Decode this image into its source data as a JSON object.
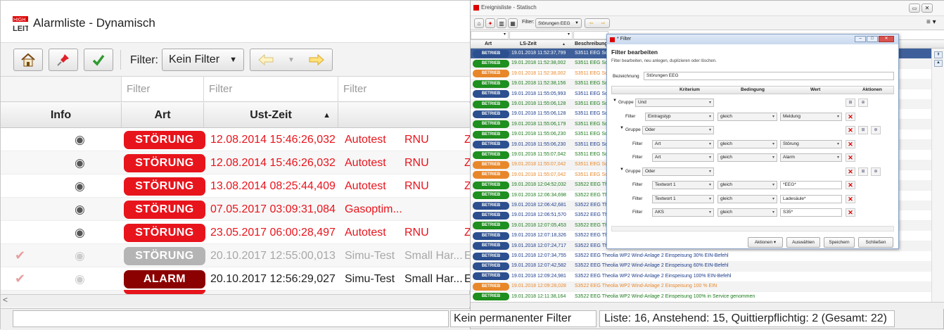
{
  "main": {
    "title": "Alarmliste - Dynamisch",
    "toolbar": {
      "filter_label": "Filter:",
      "filter_value": "Kein Filter"
    },
    "filter_placeholders": [
      "Filter",
      "Filter",
      "Filter"
    ],
    "columns": {
      "info": "Info",
      "art": "Art",
      "ust_zeit": "Ust-Zeit"
    },
    "rows": [
      {
        "art": "STÖRUNG",
        "zeit": "12.08.2014 15:46:26,032",
        "text": "Autotest",
        "kz": "RNU",
        "extra": "Z",
        "badge": "#e8141c",
        "fg": "#e8141c",
        "ack": false
      },
      {
        "art": "STÖRUNG",
        "zeit": "12.08.2014 15:46:26,032",
        "text": "Autotest",
        "kz": "RNU",
        "extra": "Z",
        "badge": "#e8141c",
        "fg": "#e8141c",
        "ack": false
      },
      {
        "art": "STÖRUNG",
        "zeit": "13.08.2014 08:25:44,409",
        "text": "Autotest",
        "kz": "RNU",
        "extra": "Z",
        "badge": "#e8141c",
        "fg": "#e8141c",
        "ack": false
      },
      {
        "art": "STÖRUNG",
        "zeit": "07.05.2017 03:09:31,084",
        "text": "Gasoptim...",
        "kz": "",
        "extra": "",
        "badge": "#e8141c",
        "fg": "#e8141c",
        "ack": false
      },
      {
        "art": "STÖRUNG",
        "zeit": "23.05.2017 06:00:28,497",
        "text": "Autotest",
        "kz": "RNU",
        "extra": "Z",
        "badge": "#e8141c",
        "fg": "#e8141c",
        "ack": false
      },
      {
        "art": "STÖRUNG",
        "zeit": "20.10.2017 12:55:00,013",
        "text": "Simu-Test",
        "kz": "Small Har...",
        "extra": "E",
        "badge": "#b4b4b4",
        "fg": "#a8a8a8",
        "ack": true
      },
      {
        "art": "ALARM",
        "zeit": "20.10.2017 12:56:29,027",
        "text": "Simu-Test",
        "kz": "Small Har...",
        "extra": "E",
        "badge": "#8b0000",
        "fg": "#222222",
        "ack": true
      }
    ],
    "status": {
      "permanent": "Kein permanenter Filter",
      "summary": "Liste: 16, Anstehend: 15, Quittierpflichtig: 2 (Gesamt: 22)"
    }
  },
  "events": {
    "title": "Ereignisliste - Statisch",
    "filter_label": "Filter:",
    "filter_value": "Störungen EEG",
    "columns": {
      "art": "Art",
      "ls_zeit": "LS-Zeit",
      "beschreibung": "Beschreibung"
    },
    "rows": [
      {
        "b": "BETRIEB",
        "c": "#2c4f8f",
        "t": "19.01.2018 11:52:37,799",
        "d": "S3511 EEG Son",
        "fg": "#1a3a8a",
        "sel": true
      },
      {
        "b": "BETRIEB",
        "c": "#1f8f1f",
        "t": "19.01.2018 11:52:38,002",
        "d": "S3511 EEG Son",
        "fg": "#1a7a1a"
      },
      {
        "b": "BETRIEB",
        "c": "#e8872a",
        "t": "19.01.2018 11:52:38,002",
        "d": "S3511 EEG Son",
        "fg": "#e8872a"
      },
      {
        "b": "BETRIEB",
        "c": "#1f8f1f",
        "t": "19.01.2018 11:52:38,156",
        "d": "S3511 EEG Son",
        "fg": "#1a7a1a"
      },
      {
        "b": "BETRIEB",
        "c": "#2c4f8f",
        "t": "19.01.2018 11:55:05,993",
        "d": "S3511 EEG Son",
        "fg": "#1a3a8a"
      },
      {
        "b": "BETRIEB",
        "c": "#1f8f1f",
        "t": "19.01.2018 11:55:06,128",
        "d": "S3511 EEG Son",
        "fg": "#1a7a1a"
      },
      {
        "b": "BETRIEB",
        "c": "#2c4f8f",
        "t": "19.01.2018 11:55:06,128",
        "d": "S3511 EEG Son",
        "fg": "#1a3a8a"
      },
      {
        "b": "BETRIEB",
        "c": "#1f8f1f",
        "t": "19.01.2018 11:55:06,179",
        "d": "S3511 EEG Son",
        "fg": "#1a7a1a"
      },
      {
        "b": "BETRIEB",
        "c": "#1f8f1f",
        "t": "19.01.2018 11:55:06,230",
        "d": "S3511 EEG Son",
        "fg": "#1a7a1a"
      },
      {
        "b": "BETRIEB",
        "c": "#2c4f8f",
        "t": "19.01.2018 11:55:06,230",
        "d": "S3511 EEG Son",
        "fg": "#1a3a8a"
      },
      {
        "b": "BETRIEB",
        "c": "#1f8f1f",
        "t": "19.01.2018 11:55:07,042",
        "d": "S3511 EEG Son",
        "fg": "#1a7a1a"
      },
      {
        "b": "BETRIEB",
        "c": "#e8872a",
        "t": "19.01.2018 11:55:07,042",
        "d": "S3511 EEG Son",
        "fg": "#e8872a"
      },
      {
        "b": "BETRIEB",
        "c": "#e8872a",
        "t": "19.01.2018 11:55:07,042",
        "d": "S3511 EEG Son",
        "fg": "#e8872a"
      },
      {
        "b": "BETRIEB",
        "c": "#1f8f1f",
        "t": "19.01.2018 12:04:52,032",
        "d": "S3522 EEG The",
        "fg": "#1a7a1a"
      },
      {
        "b": "BETRIEB",
        "c": "#1f8f1f",
        "t": "19.01.2018 12:06:34,698",
        "d": "S3522 EEG The",
        "fg": "#1a7a1a"
      },
      {
        "b": "BETRIEB",
        "c": "#2c4f8f",
        "t": "19.01.2018 12:06:42,681",
        "d": "S3522 EEG The",
        "fg": "#1a3a8a"
      },
      {
        "b": "BETRIEB",
        "c": "#2c4f8f",
        "t": "19.01.2018 12:06:51,570",
        "d": "S3522 EEG The",
        "fg": "#1a3a8a"
      },
      {
        "b": "BETRIEB",
        "c": "#1f8f1f",
        "t": "19.01.2018 12:07:05,453",
        "d": "S3522 EEG The",
        "fg": "#1a7a1a"
      },
      {
        "b": "BETRIEB",
        "c": "#2c4f8f",
        "t": "19.01.2018 12:07:18,326",
        "d": "S3522 EEG The",
        "fg": "#1a3a8a"
      },
      {
        "b": "BETRIEB",
        "c": "#2c4f8f",
        "t": "19.01.2018 12:07:24,717",
        "d": "S3522 EEG The",
        "fg": "#1a3a8a"
      },
      {
        "b": "BETRIEB",
        "c": "#2c4f8f",
        "t": "19.01.2018 12:07:34,755",
        "d": "S3522 EEG Theolia WP2 Wind-Anlage 2 Einspeisung 30% EIN-Befehl",
        "fg": "#1a3a8a"
      },
      {
        "b": "BETRIEB",
        "c": "#2c4f8f",
        "t": "19.01.2018 12:07:42,582",
        "d": "S3522 EEG Theolia WP2 Wind-Anlage 2 Einspeisung 60% EIN-Befehl",
        "fg": "#1a3a8a"
      },
      {
        "b": "BETRIEB",
        "c": "#2c4f8f",
        "t": "19.01.2018 12:09:24,981",
        "d": "S3522 EEG Theolia WP2 Wind-Anlage 2 Einspeisung 100% EIN-Befehl",
        "fg": "#1a3a8a"
      },
      {
        "b": "BETRIEB",
        "c": "#e8872a",
        "t": "19.01.2018 12:09:28,028",
        "d": "S3522 EEG Theolia WP2 Wind-Anlage 2 Einspeisung 100 % EIN",
        "fg": "#e8872a"
      },
      {
        "b": "BETRIEB",
        "c": "#1f8f1f",
        "t": "19.01.2018 12:11:38,164",
        "d": "S3522 EEG Theolia WP2 Wind-Anlage 2 Einspeisung 100% in Service genommen",
        "fg": "#1a7a1a"
      }
    ]
  },
  "dialog": {
    "window_title": "* Filter",
    "heading": "Filter bearbeiten",
    "subheading": "Filter bearbeiten, neu anlegen, duplizieren oder löschen.",
    "name_label": "Bezeichnung",
    "name_value": "Störungen EEG",
    "columns": {
      "kriterium": "Kriterium",
      "bedingung": "Bedingung",
      "wert": "Wert",
      "aktionen": "Aktionen"
    },
    "rows": [
      {
        "label": "Gruppe",
        "k": "Und",
        "b": "",
        "w": "",
        "wtype": "",
        "indent": 0,
        "x": false,
        "tools": true
      },
      {
        "label": "Filter",
        "k": "Eintragstyp",
        "b": "gleich",
        "w": "Meldung",
        "wtype": "dd",
        "indent": 1,
        "x": true,
        "tools": false
      },
      {
        "label": "Gruppe",
        "k": "Oder",
        "b": "",
        "w": "",
        "wtype": "",
        "indent": 1,
        "x": true,
        "tools": true
      },
      {
        "label": "Filter",
        "k": "Art",
        "b": "gleich",
        "w": "Störung",
        "wtype": "dd",
        "indent": 2,
        "x": true,
        "tools": false
      },
      {
        "label": "Filter",
        "k": "Art",
        "b": "gleich",
        "w": "Alarm",
        "wtype": "dd",
        "indent": 2,
        "x": true,
        "tools": false
      },
      {
        "label": "Gruppe",
        "k": "Oder",
        "b": "",
        "w": "",
        "wtype": "",
        "indent": 1,
        "x": true,
        "tools": true
      },
      {
        "label": "Filter",
        "k": "Textwort 1",
        "b": "gleich",
        "w": "*EEG*",
        "wtype": "tx",
        "indent": 2,
        "x": true,
        "tools": false
      },
      {
        "label": "Filter",
        "k": "Textwort 1",
        "b": "gleich",
        "w": "Ladesäule*",
        "wtype": "tx",
        "indent": 2,
        "x": true,
        "tools": false
      },
      {
        "label": "Filter",
        "k": "AKS",
        "b": "gleich",
        "w": "S35*",
        "wtype": "tx",
        "indent": 2,
        "x": true,
        "tools": false
      }
    ],
    "buttons": {
      "aktionen": "Aktionen",
      "auswaehlen": "Auswählen",
      "speichern": "Speichern",
      "schliessen": "Schließen"
    }
  }
}
